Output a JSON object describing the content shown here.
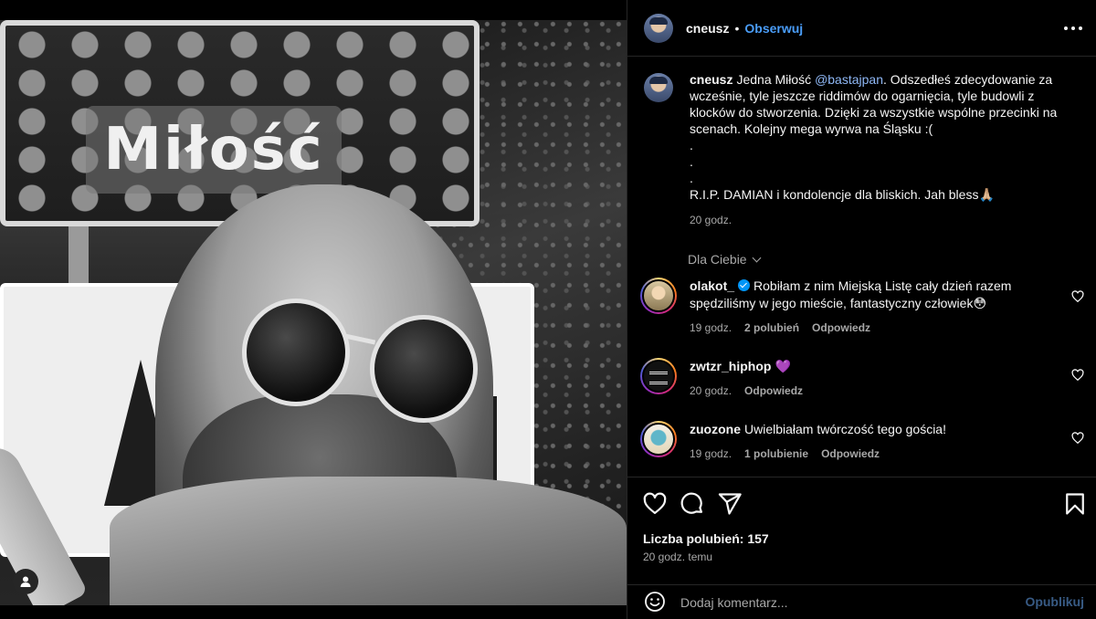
{
  "post": {
    "photo_alt": "Selfie przy znaku drogowym",
    "photo_sign_text": "Miłość"
  },
  "header": {
    "username": "cneusz",
    "separator": "•",
    "follow_label": "Obserwuj"
  },
  "caption": {
    "username": "cneusz",
    "text_before_mention": "Jedna Miłość ",
    "mention": "@bastajpan",
    "text_after_mention": ". Odszedłeś zdecydowanie za wcześnie, tyle jeszcze riddimów do ogarnięcia, tyle budowli z klocków do stworzenia. Dzięki za wszystkie wspólne przecinki na scenach. Kolejny mega wyrwa na Śląsku :(",
    "dot1": ".",
    "dot2": ".",
    "dot3": ".",
    "rip_line": "R.I.P. DAMIAN i kondolencje dla bliskich. Jah bless🙏🏼",
    "time": "20 godz."
  },
  "filter": {
    "label": "Dla Ciebie"
  },
  "comments": [
    {
      "username": "olakot_",
      "verified": true,
      "text": "Robiłam z nim Miejską Listę cały dzień razem spędziliśmy w jego mieście, fantastyczny człowiek😳",
      "time": "19 godz.",
      "likes": "2 polubień",
      "reply": "Odpowiedz"
    },
    {
      "username": "zwtzr_hiphop",
      "verified": false,
      "text": "💜",
      "time": "20 godz.",
      "likes": "",
      "reply": "Odpowiedz"
    },
    {
      "username": "zuozone",
      "verified": false,
      "text": "Uwielbiałam twórczość tego gościa!",
      "time": "19 godz.",
      "likes": "1 polubienie",
      "reply": "Odpowiedz"
    }
  ],
  "stats": {
    "likes": "Liczba polubień: 157",
    "time": "20 godz. temu"
  },
  "composer": {
    "placeholder": "Dodaj komentarz...",
    "publish_label": "Opublikuj"
  },
  "icons": {
    "more": "more-horizontal-icon",
    "heart": "heart-icon",
    "comment": "comment-icon",
    "share": "share-icon",
    "save": "bookmark-icon",
    "emoji": "emoji-icon",
    "user_tag": "user-tag-icon"
  },
  "colors": {
    "background": "#000000",
    "text": "#f5f5f5",
    "muted": "#a8a8a8",
    "accent": "#4a9df8",
    "divider": "#262626"
  }
}
